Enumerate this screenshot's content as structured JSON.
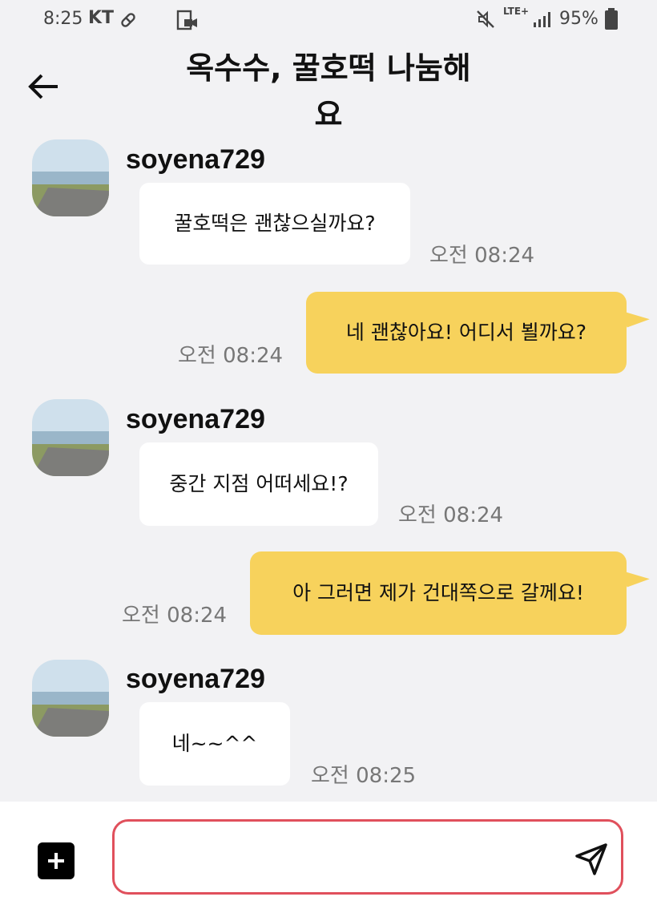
{
  "status_bar": {
    "time": "8:25",
    "carrier": "KT",
    "network": "LTE+",
    "battery": "95%"
  },
  "header": {
    "title": "옥수수, 꿀호떡 나눔해요",
    "back_icon": "arrow-left-icon"
  },
  "messages": [
    {
      "direction": "in",
      "sender": "soyena729",
      "text": "꿀호떡은 괜찮으실까요?",
      "time": "오전 08:24"
    },
    {
      "direction": "out",
      "text": "네 괜찮아요!  어디서 뵐까요?",
      "time": "오전 08:24"
    },
    {
      "direction": "in",
      "sender": "soyena729",
      "text": "중간 지점 어떠세요!?",
      "time": "오전 08:24"
    },
    {
      "direction": "out",
      "text": "아 그러면 제가 건대쪽으로 갈께요!",
      "time": "오전 08:24"
    },
    {
      "direction": "in",
      "sender": "soyena729",
      "text": "네~~^^",
      "time": "오전 08:25"
    }
  ],
  "composer": {
    "placeholder": "",
    "plus_icon": "plus-icon",
    "send_icon": "send-icon"
  },
  "colors": {
    "outgoing_bubble": "#f7d25c",
    "incoming_bubble": "#ffffff",
    "background": "#f2f2f4",
    "input_border": "#e0505c"
  }
}
